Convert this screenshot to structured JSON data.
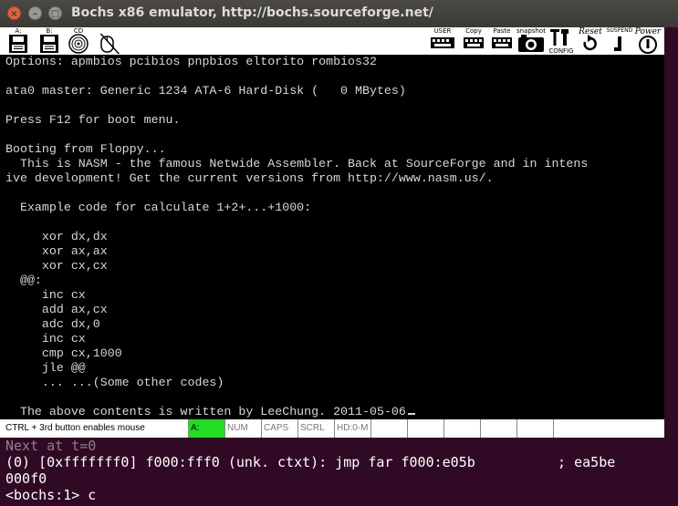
{
  "window": {
    "title": "Bochs x86 emulator, http://bochs.sourceforge.net/",
    "close_glyph": "×",
    "min_glyph": "–",
    "max_glyph": "□"
  },
  "toolbar": {
    "left": [
      {
        "label": "A:",
        "icon": "floppy-a-icon"
      },
      {
        "label": "B:",
        "icon": "floppy-b-icon"
      },
      {
        "label": "CD",
        "icon": "cdrom-icon"
      },
      {
        "label": "",
        "icon": "mouse-icon"
      }
    ],
    "right": [
      {
        "label": "USER",
        "icon": "user-icon"
      },
      {
        "label": "Copy",
        "icon": "copy-icon"
      },
      {
        "label": "Paste",
        "icon": "paste-icon"
      },
      {
        "label": "snapshot",
        "icon": "snapshot-icon"
      },
      {
        "label": "CONFIG",
        "icon": "config-icon"
      },
      {
        "label": "Reset",
        "icon": "reset-icon"
      },
      {
        "label": "SUSPEND",
        "icon": "suspend-icon"
      },
      {
        "label": "Power",
        "icon": "power-icon"
      }
    ]
  },
  "screen": {
    "lines": [
      "Options: apmbios pcibios pnpbios eltorito rombios32",
      "",
      "ata0 master: Generic 1234 ATA-6 Hard-Disk (   0 MBytes)",
      "",
      "Press F12 for boot menu.",
      "",
      "Booting from Floppy...",
      "  This is NASM - the famous Netwide Assembler. Back at SourceForge and in intens",
      "ive development! Get the current versions from http://www.nasm.us/.",
      "",
      "  Example code for calculate 1+2+...+1000:",
      "",
      "     xor dx,dx",
      "     xor ax,ax",
      "     xor cx,cx",
      "  @@:",
      "     inc cx",
      "     add ax,cx",
      "     adc dx,0",
      "     inc cx",
      "     cmp cx,1000",
      "     jle @@",
      "     ... ...(Some other codes)",
      "",
      "  The above contents is written by LeeChung. 2011-05-06"
    ]
  },
  "statusbar": {
    "message": "CTRL + 3rd button enables mouse",
    "cells": [
      "A:",
      "NUM",
      "CAPS",
      "SCRL",
      "HD:0-M",
      "",
      "",
      "",
      "",
      "",
      ""
    ],
    "active_color": "#22dd22"
  },
  "console": {
    "lines": [
      "Next at t=0",
      "(0) [0xfffffff0] f000:fff0 (unk. ctxt): jmp far f000:e05b          ; ea5be",
      "000f0",
      "<bochs:1> c"
    ]
  },
  "colors": {
    "terminal_bg": "#300a24",
    "screen_bg": "#000000",
    "screen_fg": "#d8d8d8"
  }
}
